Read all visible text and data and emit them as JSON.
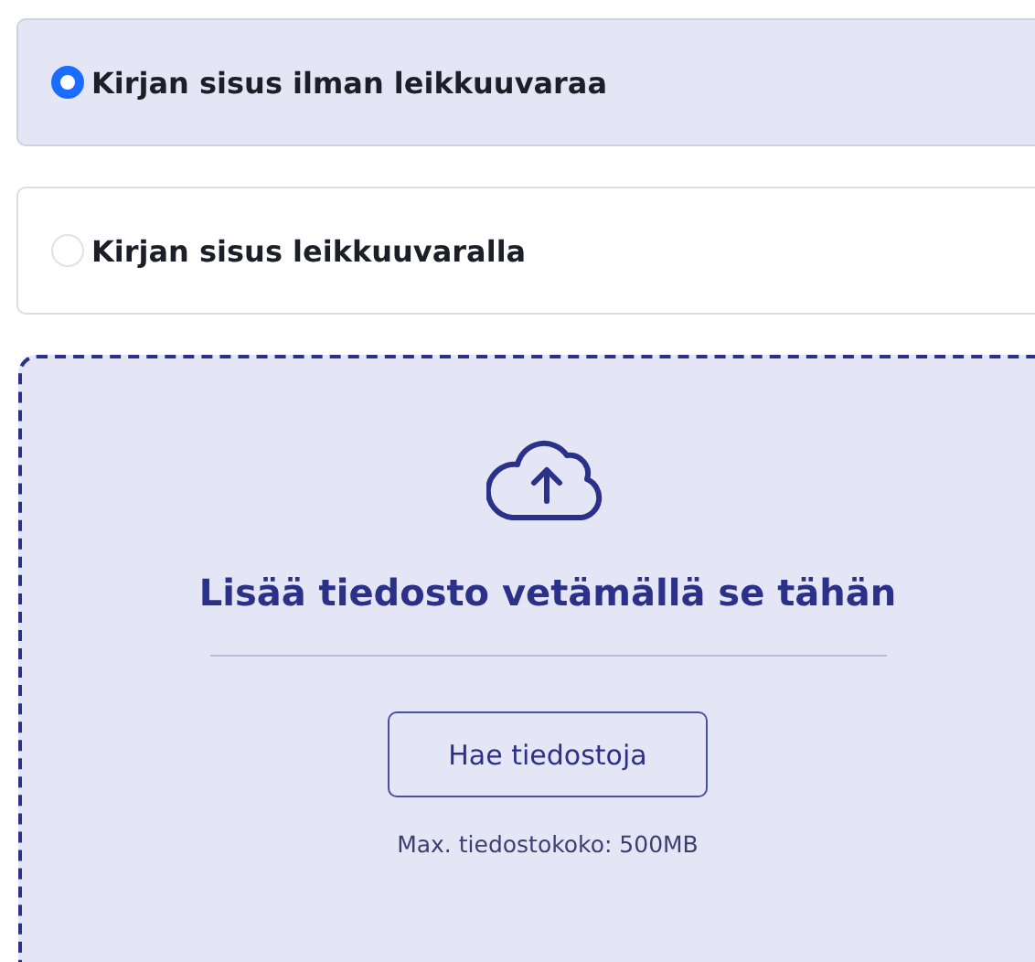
{
  "options": [
    {
      "label": "Kirjan sisus ilman leikkuuvaraa",
      "selected": true
    },
    {
      "label": "Kirjan sisus leikkuuvaralla",
      "selected": false
    }
  ],
  "dropzone": {
    "heading": "Lisää tiedosto vetämällä se tähän",
    "button": "Hae tiedostoja",
    "note": "Max. tiedostokoko: 500MB"
  }
}
